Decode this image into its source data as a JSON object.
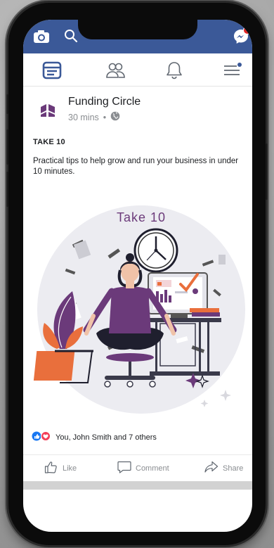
{
  "header": {
    "brand_color": "#3b5998",
    "icons": [
      "camera-icon",
      "search-icon",
      "messenger-icon"
    ]
  },
  "nav": {
    "items": [
      "feed-icon",
      "friends-icon",
      "notifications-icon",
      "menu-icon"
    ]
  },
  "post": {
    "page_name": "Funding Circle",
    "time": "30 mins",
    "separator": "•",
    "title": "TAKE 10",
    "text": "Practical tips to help grow and run your business in under 10 minutes.",
    "image": {
      "heading": "Take 10",
      "accent_color": "#6b3a7a"
    },
    "reactions_text": "You, John Smith and 7 others",
    "actions": {
      "like": "Like",
      "comment": "Comment",
      "share": "Share"
    }
  }
}
